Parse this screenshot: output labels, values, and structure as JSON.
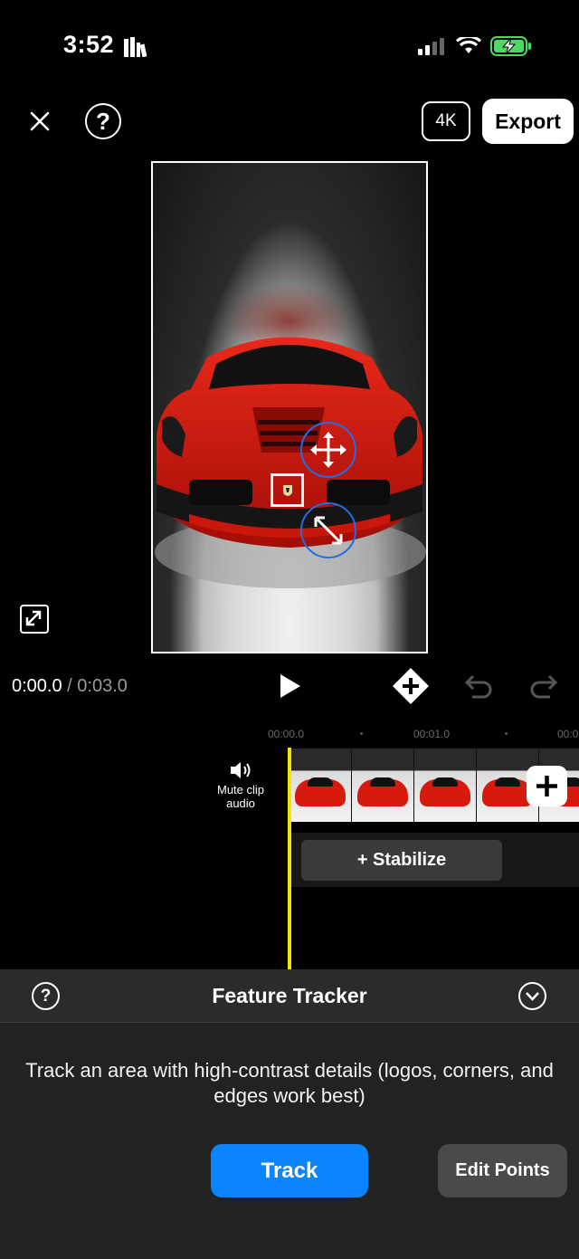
{
  "status": {
    "time": "3:52",
    "icons": [
      "library-icon",
      "signal-icon",
      "wifi-icon",
      "battery-charging-icon"
    ],
    "battery_color": "#4cd964"
  },
  "toolbar": {
    "close_icon": "close-icon",
    "help_label": "?",
    "resolution_label": "4K",
    "export_label": "Export"
  },
  "preview": {
    "overlay_icons": [
      "move-icon",
      "resize-icon",
      "tracker-box"
    ],
    "handle_color": "#1f6fe5"
  },
  "playback": {
    "current_time": "0:00.0",
    "separator": " / ",
    "total_time": "0:03.0",
    "icons": [
      "play-icon",
      "add-keyframe-icon",
      "undo-icon",
      "redo-icon"
    ]
  },
  "ruler": {
    "labels": [
      "00:00.0",
      "00:01.0",
      "00:0"
    ]
  },
  "timeline": {
    "mute_label": "Mute clip audio",
    "frame_count": 5,
    "stabilize_label": "+ Stabilize",
    "playhead_color": "#f5e400"
  },
  "panel": {
    "title": "Feature Tracker",
    "help_label": "?",
    "description": "Track an area with high-contrast details (logos, corners, and edges work best)",
    "track_label": "Track",
    "edit_points_label": "Edit Points",
    "accent": "#0a84ff"
  }
}
